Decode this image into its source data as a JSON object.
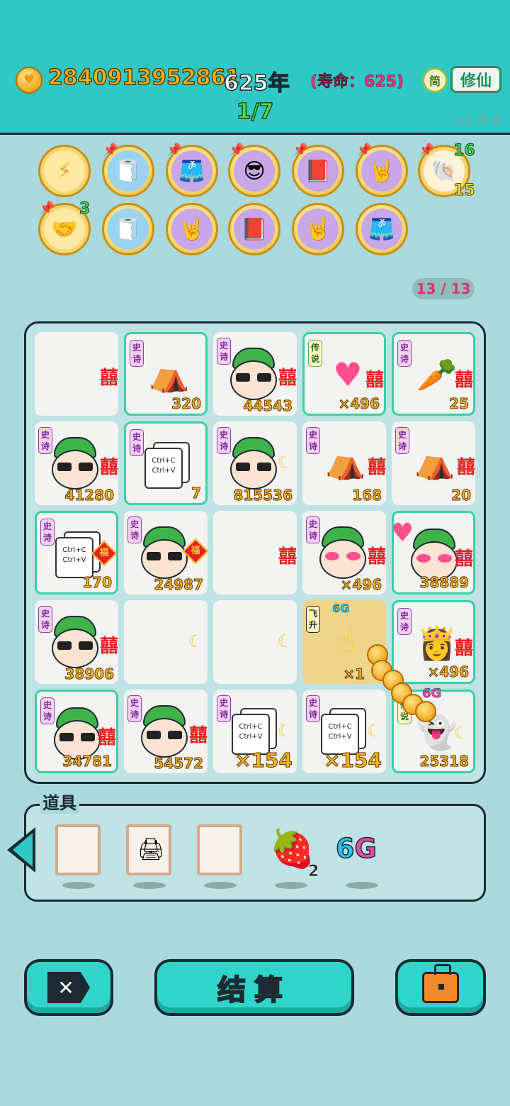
{
  "header": {
    "money": "2840913952861",
    "years": "625年",
    "lifespan": "(寿命：625)",
    "lang_button": "简",
    "cultivate_button": "修仙",
    "page_indicator": "1/7",
    "version": "v3.4.4"
  },
  "relics": {
    "handshake_count": "3",
    "shell_count_top": "16",
    "shell_count_bottom": "15",
    "counter": "13 / 13"
  },
  "board": {
    "tag_epic": "史诗",
    "tag_legend": "传说",
    "tag_fly": "飞升",
    "xi": "囍",
    "fu": "福",
    "cells": [
      {
        "num": ""
      },
      {
        "num": "320"
      },
      {
        "num": "44543"
      },
      {
        "num": "×496"
      },
      {
        "num": "25"
      },
      {
        "num": "41280"
      },
      {
        "num": "7",
        "card_text": "Ctrl+C Ctrl+V"
      },
      {
        "num": "815536"
      },
      {
        "num": "168"
      },
      {
        "num": "20"
      },
      {
        "num": "170",
        "card_text": "Ctrl+C Ctrl+V"
      },
      {
        "num": "24987"
      },
      {
        "num": ""
      },
      {
        "num": "×496"
      },
      {
        "num": "38889"
      },
      {
        "num": "38906"
      },
      {
        "num": ""
      },
      {
        "num": ""
      },
      {
        "num": "×1",
        "label": "6G"
      },
      {
        "num": "×496"
      },
      {
        "num": "34781"
      },
      {
        "num": "54572"
      },
      {
        "num": "×154",
        "card_text": "Ctrl+C Ctrl+V"
      },
      {
        "num": "×154",
        "card_text": "Ctrl+C Ctrl+V"
      },
      {
        "num": "25318",
        "label": "6G"
      }
    ]
  },
  "tools": {
    "title": "道具",
    "strawberry_count": "2",
    "sixg_a": "6",
    "sixg_b": "G"
  },
  "buttons": {
    "settle": "结算"
  },
  "colors": {
    "header_bg": "#2fc8c4",
    "page_bg": "#a9d9dc",
    "money_gold": "#f7b31f",
    "lifespan_pink": "#e8337d"
  }
}
